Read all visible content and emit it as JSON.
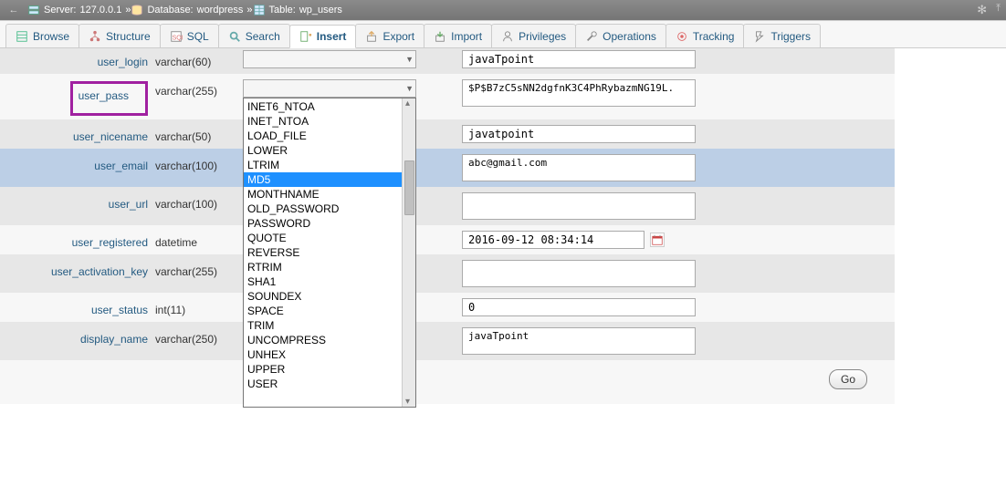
{
  "breadcrumb": {
    "server_label": "Server:",
    "server_value": "127.0.0.1",
    "database_label": "Database:",
    "database_value": "wordpress",
    "table_label": "Table:",
    "table_value": "wp_users"
  },
  "tabs": {
    "browse": "Browse",
    "structure": "Structure",
    "sql": "SQL",
    "search": "Search",
    "insert": "Insert",
    "export": "Export",
    "import": "Import",
    "privileges": "Privileges",
    "operations": "Operations",
    "tracking": "Tracking",
    "triggers": "Triggers"
  },
  "fields": {
    "user_login": {
      "name": "user_login",
      "type": "varchar(60)",
      "value": "javaTpoint"
    },
    "user_pass": {
      "name": "user_pass",
      "type": "varchar(255)",
      "value": "$P$B7zC5sNN2dgfnK3C4PhRybazmNG19L."
    },
    "user_nicename": {
      "name": "user_nicename",
      "type": "varchar(50)",
      "value": "javatpoint"
    },
    "user_email": {
      "name": "user_email",
      "type": "varchar(100)",
      "value": "abc@gmail.com"
    },
    "user_url": {
      "name": "user_url",
      "type": "varchar(100)",
      "value": ""
    },
    "user_registered": {
      "name": "user_registered",
      "type": "datetime",
      "value": "2016-09-12 08:34:14"
    },
    "user_activation_key": {
      "name": "user_activation_key",
      "type": "varchar(255)",
      "value": ""
    },
    "user_status": {
      "name": "user_status",
      "type": "int(11)",
      "value": "0"
    },
    "display_name": {
      "name": "display_name",
      "type": "varchar(250)",
      "value": "javaTpoint"
    }
  },
  "dropdown": {
    "selected": "MD5",
    "items": [
      "INET6_NTOA",
      "INET_NTOA",
      "LOAD_FILE",
      "LOWER",
      "LTRIM",
      "MD5",
      "MONTHNAME",
      "OLD_PASSWORD",
      "PASSWORD",
      "QUOTE",
      "REVERSE",
      "RTRIM",
      "SHA1",
      "SOUNDEX",
      "SPACE",
      "TRIM",
      "UNCOMPRESS",
      "UNHEX",
      "UPPER",
      "USER"
    ]
  },
  "buttons": {
    "go": "Go"
  }
}
